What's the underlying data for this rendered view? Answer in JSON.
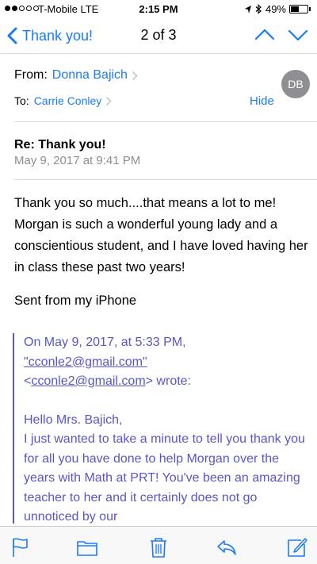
{
  "status_bar": {
    "carrier": "T-Mobile  LTE",
    "time": "2:15 PM",
    "battery_percent": "49%",
    "battery_level": 0.49,
    "signal_strength": 2
  },
  "nav": {
    "back_label": "Thank you!",
    "page_indicator": "2 of 3"
  },
  "header": {
    "from_label": "From:",
    "from_name": "Donna Bajich",
    "to_label": "To:",
    "to_name": "Carrie Conley",
    "avatar_initials": "DB",
    "hide_label": "Hide",
    "subject": "Re: Thank you!",
    "date": "May 9, 2017 at 9:41 PM"
  },
  "message": {
    "body": "Thank you so much....that means a lot to me! Morgan is such a wonderful young lady and a conscientious student, and I have loved having her in class these past two years!",
    "signature": "Sent from my iPhone"
  },
  "quoted": {
    "header_line1": "On May 9, 2017, at 5:33 PM,",
    "email_quoted": "\"cconle2@gmail.com\"",
    "lt": "<",
    "email": "cconle2@gmail.com",
    "wrote": "> wrote:",
    "greeting": "Hello Mrs. Bajich,",
    "body": "I just wanted to take a minute to tell you thank you for all you have done to help Morgan over the years with Math at PRT!  You've been an amazing teacher to her and it certainly does not go unnoticed by our"
  },
  "colors": {
    "accent": "#1a7cf5",
    "quote": "#5a55c8",
    "avatar_bg": "#8e8e93"
  },
  "toolbar": {
    "icons": [
      "flag-icon",
      "folder-icon",
      "trash-icon",
      "reply-icon",
      "compose-icon"
    ]
  }
}
